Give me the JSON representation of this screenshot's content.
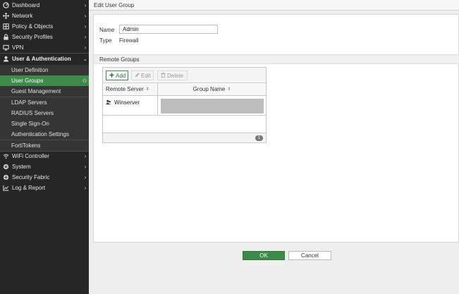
{
  "sidebar": {
    "items": [
      {
        "label": "Dashboard",
        "icon": "dashboard-icon"
      },
      {
        "label": "Network",
        "icon": "network-icon"
      },
      {
        "label": "Policy & Objects",
        "icon": "policy-icon"
      },
      {
        "label": "Security Profiles",
        "icon": "lock-icon"
      },
      {
        "label": "VPN",
        "icon": "monitor-icon"
      },
      {
        "label": "User & Authentication",
        "icon": "user-icon"
      }
    ],
    "sub_items": [
      {
        "label": "User Definition"
      },
      {
        "label": "User Groups"
      },
      {
        "label": "Guest Management"
      },
      {
        "label": "LDAP Servers"
      },
      {
        "label": "RADIUS Servers"
      },
      {
        "label": "Single Sign-On"
      },
      {
        "label": "Authentication Settings"
      },
      {
        "label": "FortiTokens"
      }
    ],
    "bottom_items": [
      {
        "label": "WiFi Controller",
        "icon": "wifi-icon"
      },
      {
        "label": "System",
        "icon": "gear-icon"
      },
      {
        "label": "Security Fabric",
        "icon": "fabric-icon"
      },
      {
        "label": "Log & Report",
        "icon": "chart-icon"
      }
    ]
  },
  "main": {
    "title": "Edit User Group",
    "name_label": "Name",
    "name_value": "Admin",
    "type_label": "Type",
    "type_value": "Firewall",
    "remote_groups": {
      "heading": "Remote Groups",
      "toolbar": {
        "add": "Add",
        "edit": "Edit",
        "delete": "Delete"
      },
      "columns": [
        "Remote Server",
        "Group Name"
      ],
      "rows": [
        {
          "server": "Winserver",
          "group": ""
        }
      ],
      "count": "1"
    },
    "buttons": {
      "ok": "OK",
      "cancel": "Cancel"
    }
  },
  "colors": {
    "accent": "#3d8a4a",
    "sidebar_bg": "#262626"
  }
}
